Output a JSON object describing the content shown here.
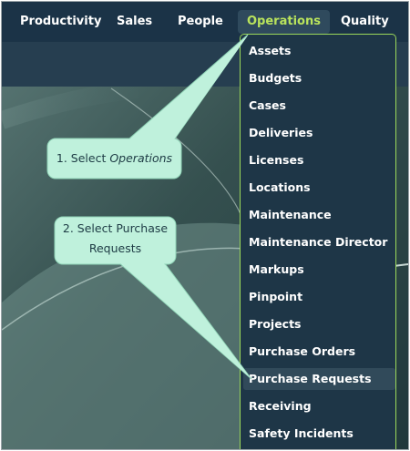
{
  "nav": {
    "items": [
      {
        "label": "Productivity",
        "active": false
      },
      {
        "label": "Sales",
        "active": false
      },
      {
        "label": "People",
        "active": false
      },
      {
        "label": "Operations",
        "active": true
      },
      {
        "label": "Quality",
        "active": false
      }
    ]
  },
  "dropdown": {
    "items": [
      {
        "label": "Assets"
      },
      {
        "label": "Budgets"
      },
      {
        "label": "Cases"
      },
      {
        "label": "Deliveries"
      },
      {
        "label": "Licenses"
      },
      {
        "label": "Locations"
      },
      {
        "label": "Maintenance"
      },
      {
        "label": "Maintenance Director"
      },
      {
        "label": "Markups"
      },
      {
        "label": "Pinpoint"
      },
      {
        "label": "Projects"
      },
      {
        "label": "Purchase Orders"
      },
      {
        "label": "Purchase Requests",
        "highlighted": true
      },
      {
        "label": "Receiving"
      },
      {
        "label": "Safety Incidents"
      }
    ]
  },
  "callouts": {
    "step1_prefix": "1. Select ",
    "step1_emphasis": "Operations",
    "step2_line1": "2. Select Purchase",
    "step2_line2": "Requests"
  },
  "colors": {
    "nav_bg": "#1b3347",
    "active_text": "#b9e35c",
    "menu_border": "#9bd85a",
    "callout_fill": "#bff1dc"
  }
}
